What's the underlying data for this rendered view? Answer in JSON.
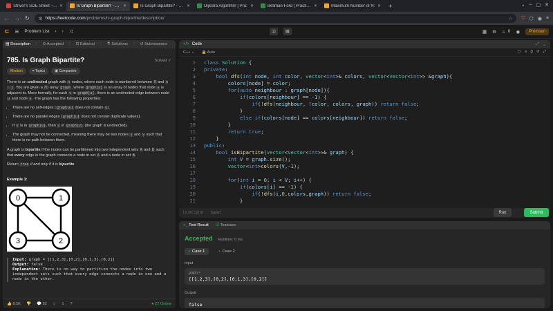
{
  "browser": {
    "tabs": [
      {
        "label": "Striver's SDE Sheet – To:",
        "color": "#e53935",
        "active": false
      },
      {
        "label": "Is Graph Bipartite? - Lee:",
        "color": "#ffa116",
        "active": true
      },
      {
        "label": "Is Graph Bipartite? - Lee:",
        "color": "#ffa116",
        "active": false
      },
      {
        "label": "Dijkstra Algorithm | Pra:",
        "color": "#2f8d46",
        "active": false
      },
      {
        "label": "Bellman-Ford | Practice |",
        "color": "#2f8d46",
        "active": false
      },
      {
        "label": "Maximum Number of N:",
        "color": "#ffa116",
        "active": false
      }
    ],
    "new_tab": "+",
    "url_host": "https://leetcode.com",
    "url_path": "/problems/is-graph-bipartite/description/"
  },
  "topbar": {
    "problem_list": "Problem List",
    "coins": "0",
    "premium": "Premium"
  },
  "left": {
    "tabs": [
      "Description",
      "Accepted",
      "Editorial",
      "Solutions",
      "Submissions"
    ],
    "title": "785. Is Graph Bipartite?",
    "solved": "Solved ✓",
    "badges": {
      "difficulty": "Medium",
      "topics": "Topics",
      "companies": "Companies"
    },
    "desc": {
      "p1a": "There is an ",
      "p1b": "undirected",
      "p1c": " graph with ",
      "n": "n",
      "p1d": " nodes, where each node is numbered between ",
      "zero": "0",
      "p1e": " and ",
      "nminus1": "n - 1",
      "p1f": ". You are given a 2D array ",
      "graph": "graph",
      "p1g": ", where ",
      "graphu": "graph[u]",
      "p1h": " is an array of nodes that node ",
      "u": "u",
      "p1i": " is adjacent to. More formally, for each ",
      "v": "v",
      "p1j": " in ",
      "p1k": ", there is an undirected edge between node ",
      "p1l": " and node ",
      "p1m": ". The graph has the following properties:"
    },
    "props": {
      "b1a": "There are no self-edges (",
      "b1b": " does not contain ",
      "b1c": ").",
      "b2a": "There are no parallel edges (",
      "b2b": " does not contain duplicate values).",
      "b3a": "If ",
      "b3b": " is in ",
      "b3c": ", then ",
      "graphv": "graph[v]",
      "b3d": " (the graph is undirected).",
      "b4a": "The graph may not be connected, meaning there may be two nodes ",
      "b4b": " and ",
      "b4c": " such that there is no path between them."
    },
    "bip": {
      "a": "A graph is ",
      "b": "bipartite",
      "c": " if the nodes can be partitioned into two independent sets ",
      "A": "A",
      "d": " and ",
      "B": "B",
      "e": " such that ",
      "every": "every",
      "f": " edge in the graph connects a node in set ",
      "g": " and a node in set ",
      "h": "."
    },
    "ret": {
      "a": "Return ",
      "true": "true",
      "b": " if and only if it is ",
      "c": "bipartite",
      "d": "."
    },
    "example_heading": "Example 1:",
    "graph_nodes": [
      "0",
      "1",
      "3",
      "2"
    ],
    "example": {
      "input_label": "Input:",
      "input": " graph = [[1,2,3],[0,2],[0,1,3],[0,2]]",
      "output_label": "Output:",
      "output": " false",
      "expl_label": "Explanation:",
      "expl": " There is no way to partition the nodes into two independent sets such that every edge connects a node in one and a node in the other."
    },
    "footer": {
      "likes": "8.5K",
      "comments": "92",
      "online": "27 Online"
    }
  },
  "code": {
    "header": "Code",
    "lang": "C++",
    "auto": "Auto",
    "status_pos": "Ln 20, Col 31",
    "status_saved": "Saved",
    "run": "Run",
    "submit": "Submit"
  },
  "test": {
    "tabs": [
      "Test Result",
      "Testcase"
    ],
    "verdict": "Accepted",
    "runtime": "Runtime: 0 ms",
    "cases": [
      "Case 1",
      "Case 2"
    ],
    "input_label": "Input",
    "var_name": "graph =",
    "input_value": "[[1,2,3],[0,2],[0,1,3],[0,2]]",
    "output_label": "Output",
    "output_value": "false"
  }
}
